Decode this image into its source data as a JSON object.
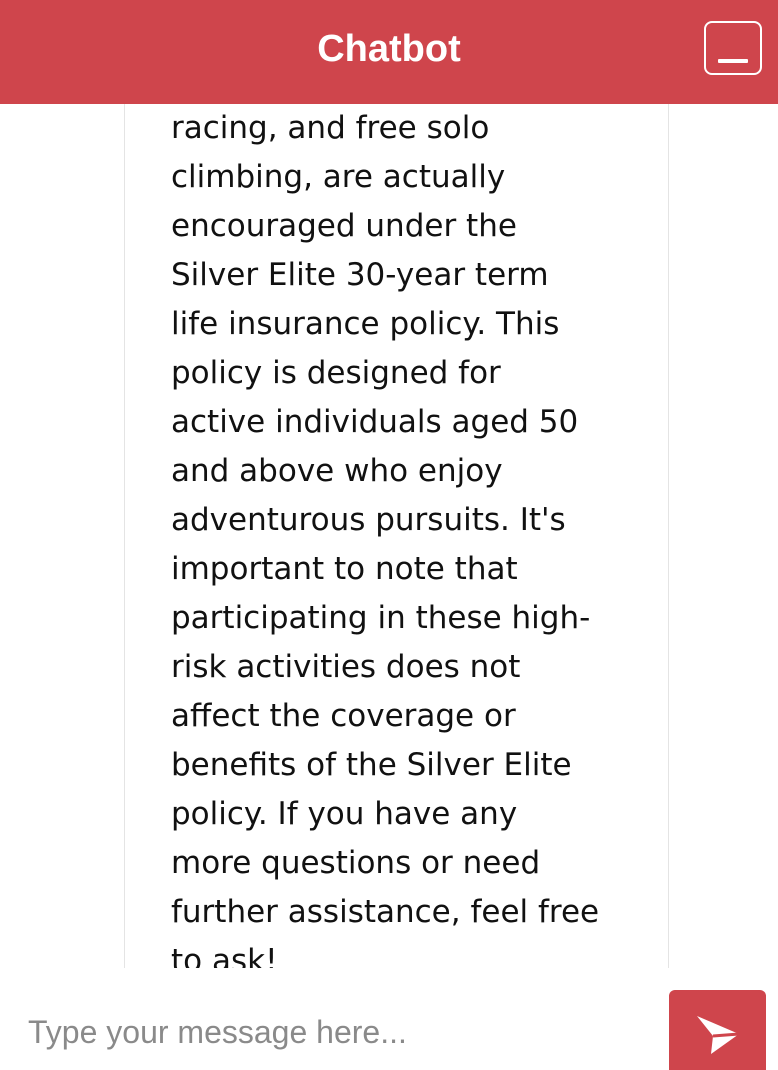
{
  "header": {
    "title": "Chatbot",
    "minimize_icon": "minimize-icon"
  },
  "chat": {
    "messages": [
      {
        "sender": "bot",
        "text": "racing, and free solo\nclimbing, are actually\nencouraged under the\nSilver Elite 30-year term\nlife insurance policy. This\npolicy is designed for\nactive individuals aged 50\nand above who enjoy\nadventurous pursuits. It's\nimportant to note that\nparticipating in these high-\nrisk activities does not\naffect the coverage or\nbenefits of the Silver Elite\npolicy. If you have any\nmore questions or need\nfurther assistance, feel free\nto ask!"
      }
    ]
  },
  "input": {
    "placeholder": "Type your message here...",
    "value": ""
  },
  "send": {
    "icon": "send-icon"
  },
  "colors": {
    "accent": "#cf454c",
    "text": "#111111",
    "placeholder": "#8a8a8a"
  }
}
